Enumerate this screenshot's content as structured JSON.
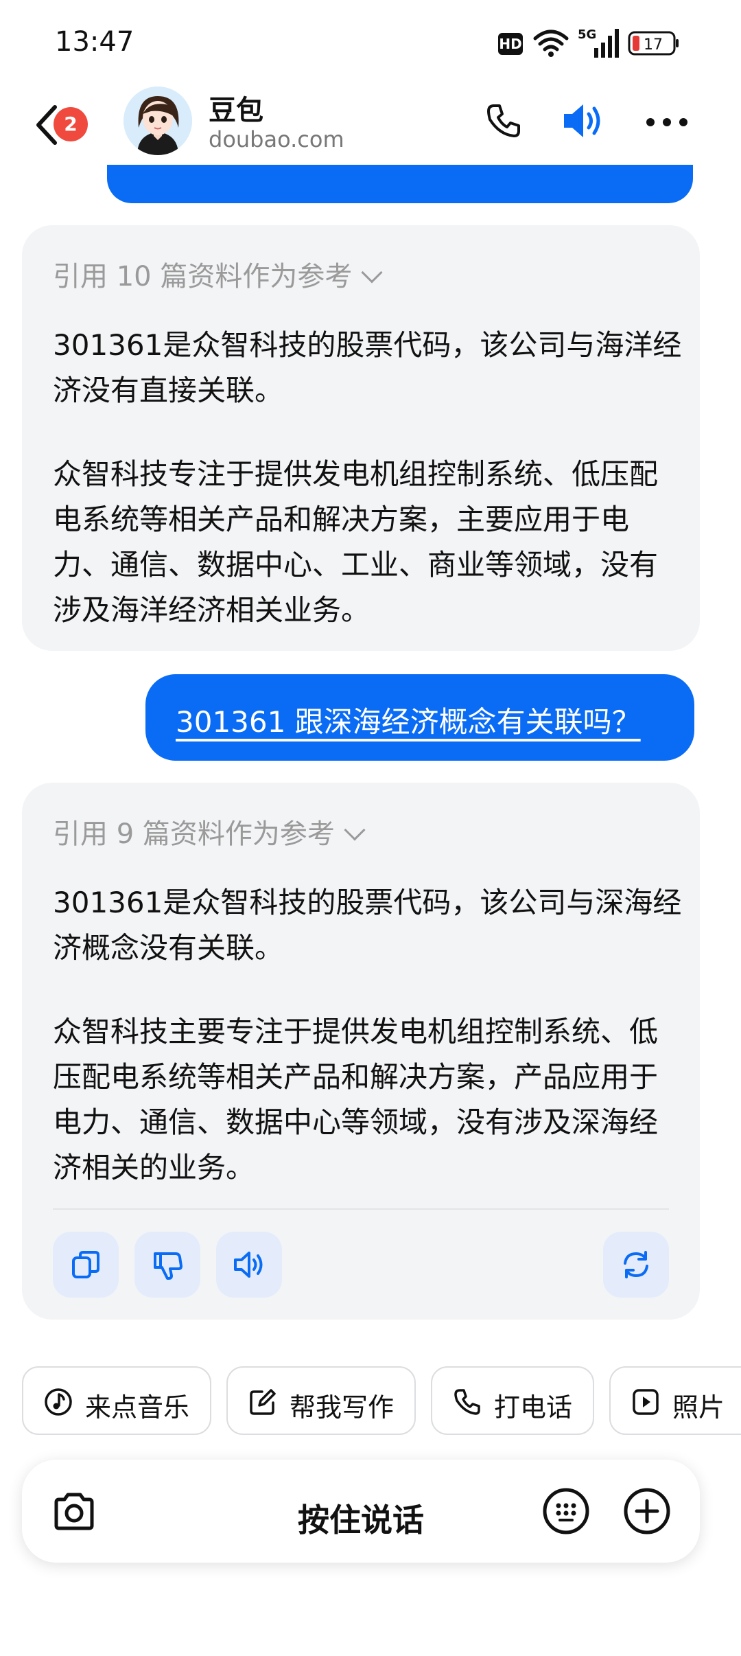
{
  "status_bar": {
    "time": "13:47",
    "hd": "HD",
    "network": "5G",
    "battery": "17"
  },
  "header": {
    "unread_count": "2",
    "name": "豆包",
    "domain": "doubao.com",
    "icons": [
      "back-icon",
      "phone-icon",
      "speaker-icon",
      "more-icon"
    ]
  },
  "chat": {
    "answer1": {
      "reference": "引用 10 篇资料作为参考",
      "para1": "301361是众智科技的股票代码，该公司与海洋经济没有直接关联。",
      "para2": "众智科技专注于提供发电机组控制系统、低压配电系统等相关产品和解决方案，主要应用于电力、通信、数据中心、工业、商业等领域，没有涉及海洋经济相关业务。"
    },
    "question": "301361 跟深海经济概念有关联吗？",
    "answer2": {
      "reference": "引用 9 篇资料作为参考",
      "para1": "301361是众智科技的股票代码，该公司与深海经济概念没有关联。",
      "para2": "众智科技主要专注于提供发电机组控制系统、低压配电系统等相关产品和解决方案，产品应用于电力、通信、数据中心等领域，没有涉及深海经济相关的业务。",
      "actions": [
        "copy-icon",
        "dislike-icon",
        "read-aloud-icon",
        "regenerate-icon"
      ]
    }
  },
  "suggestions": [
    {
      "label": "来点音乐",
      "icon": "music-icon"
    },
    {
      "label": "帮我写作",
      "icon": "edit-icon"
    },
    {
      "label": "打电话",
      "icon": "phone-icon"
    },
    {
      "label": "照片",
      "icon": "play-icon"
    }
  ],
  "input_bar": {
    "hold_to_talk": "按住说话",
    "icons": [
      "camera-icon",
      "keyboard-icon",
      "plus-icon"
    ]
  },
  "colors": {
    "accent": "#0a6cf5",
    "card_bg": "#f3f4f6",
    "badge": "#f04a3e",
    "action_bg": "#e4ecfb"
  }
}
